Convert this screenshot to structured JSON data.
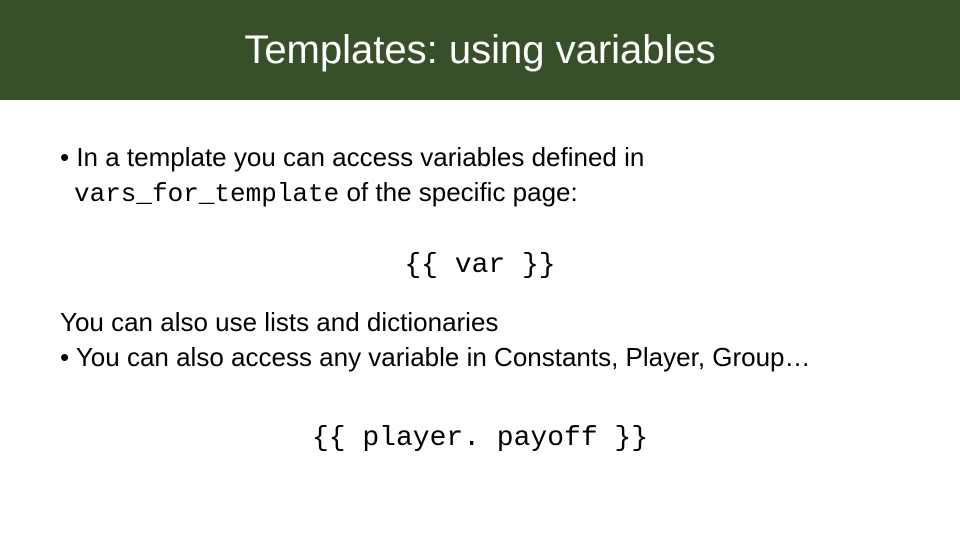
{
  "header": {
    "title": "Templates: using variables"
  },
  "body": {
    "b1_lead": "• In a template you can access variables defined in",
    "b1_code": "vars_for_template",
    "b1_tail": " of the specific page:",
    "code1": "{{ var }}",
    "line2": "You can also use lists and dictionaries",
    "b2": "• You can also access any variable in Constants, Player, Group…",
    "code2": "{{ player. payoff }}"
  }
}
